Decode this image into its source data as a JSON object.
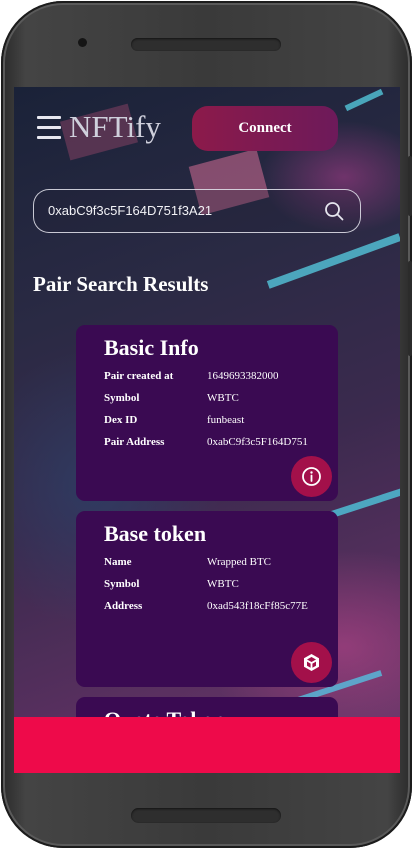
{
  "header": {
    "brand": "NFTify",
    "connect_label": "Connect"
  },
  "search": {
    "value": "0xabC9f3c5F164D751f3A21"
  },
  "results_title": "Pair Search Results",
  "cards": {
    "basic": {
      "title": "Basic Info",
      "rows": [
        {
          "label": "Pair created at",
          "value": "1649693382000"
        },
        {
          "label": "Symbol",
          "value": "WBTC"
        },
        {
          "label": "Dex ID",
          "value": "funbeast"
        },
        {
          "label": "Pair Address",
          "value": "0xabC9f3c5F164D751"
        }
      ]
    },
    "base": {
      "title": "Base token",
      "rows": [
        {
          "label": "Name",
          "value": "Wrapped BTC"
        },
        {
          "label": "Symbol",
          "value": "WBTC"
        },
        {
          "label": "Address",
          "value": "0xad543f18cFf85c77E"
        }
      ]
    },
    "quote": {
      "title": "Quote Token"
    }
  },
  "icons": {
    "menu": "hamburger-menu-icon",
    "search": "search-icon",
    "info": "info-icon",
    "token": "cube-icon"
  },
  "colors": {
    "accent": "#a3104a",
    "card_bg": "#3a0a52",
    "bottom_bar": "#ee0a4a"
  }
}
